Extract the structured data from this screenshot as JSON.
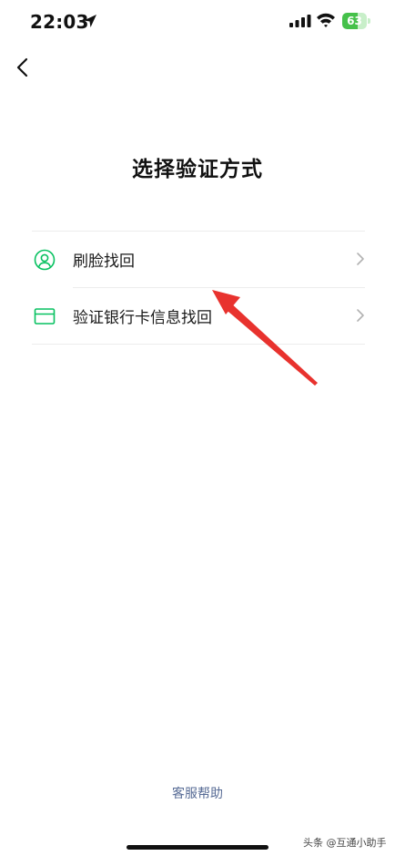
{
  "status_bar": {
    "time": "22:03",
    "battery": "63",
    "battery_fraction": 0.63,
    "battery_color": "#45c14a"
  },
  "page": {
    "title": "选择验证方式",
    "back_icon": "chevron-left-icon"
  },
  "options": [
    {
      "label": "刷脸找回",
      "icon": "face-recognition-icon"
    },
    {
      "label": "验证银行卡信息找回",
      "icon": "bank-card-icon"
    }
  ],
  "accent_color": "#07c160",
  "help_link": "客服帮助",
  "watermark": "头条 @互通小助手"
}
